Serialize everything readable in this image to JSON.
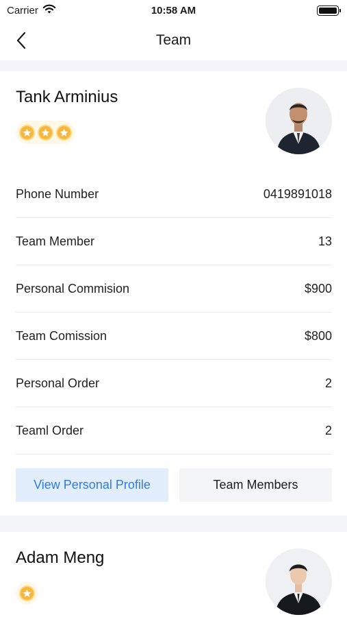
{
  "status_bar": {
    "carrier": "Carrier",
    "time": "10:58 AM",
    "icons": [
      "wifi-icon",
      "battery-icon"
    ]
  },
  "nav": {
    "title": "Team",
    "back_icon": "chevron-left-icon"
  },
  "members": [
    {
      "name": "Tank Arminius",
      "stars": 3,
      "star_icon": "star-coin-icon",
      "avatar": "person-in-suit",
      "details": [
        {
          "label": "Phone Number",
          "value": "0419891018"
        },
        {
          "label": "Team Member",
          "value": "13"
        },
        {
          "label": "Personal Commision",
          "value": "$900"
        },
        {
          "label": "Team Comission",
          "value": "$800"
        },
        {
          "label": "Personal Order",
          "value": "2"
        },
        {
          "label": "Teaml Order",
          "value": "2"
        }
      ],
      "actions": {
        "view_profile": "View Personal Profile",
        "team_members": "Team Members"
      }
    },
    {
      "name": "Adam Meng",
      "stars": 1,
      "star_icon": "star-coin-icon",
      "avatar": "person-in-suit"
    }
  ],
  "colors": {
    "accent": "#2d7ce6",
    "accent_bg": "#e3eefc",
    "star": "#f6b73c",
    "page_bg": "#f4f5f7"
  }
}
